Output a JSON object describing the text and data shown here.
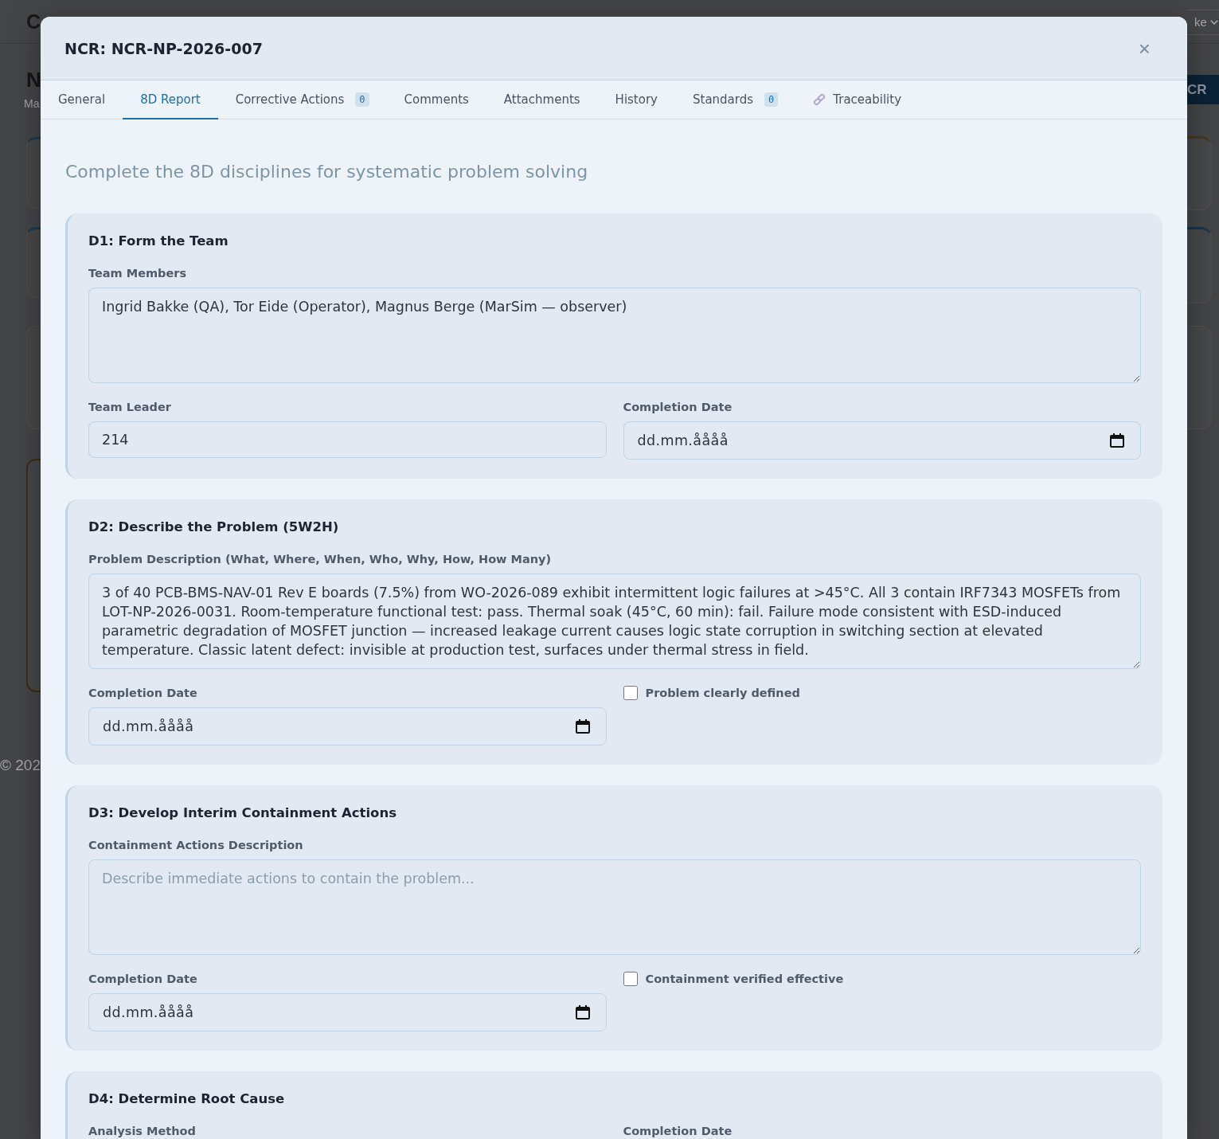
{
  "backdrop": {
    "logo": "C",
    "user_menu": "ke",
    "page_title": "N",
    "page_subtitle": "Ma",
    "action_button": "CR",
    "footer": "© 202"
  },
  "modal": {
    "title": "NCR: NCR-NP-2026-007",
    "close": "×"
  },
  "tabs": [
    {
      "kind": "plain",
      "label": "General",
      "selected": false
    },
    {
      "kind": "plain",
      "label": "8D Report",
      "selected": true
    },
    {
      "kind": "count",
      "label": "Corrective Actions",
      "badge": "0",
      "selected": false
    },
    {
      "kind": "plain",
      "label": "Comments",
      "selected": false
    },
    {
      "kind": "plain",
      "label": "Attachments",
      "selected": false
    },
    {
      "kind": "plain",
      "label": "History",
      "selected": false
    },
    {
      "kind": "count",
      "label": "Standards",
      "badge": "0",
      "selected": false
    },
    {
      "kind": "icon",
      "label": "Traceability",
      "selected": false
    }
  ],
  "intro": "Complete the 8D disciplines for systematic problem solving",
  "disciplines": [
    {
      "title": "D1: Form the Team",
      "fields": [
        {
          "kind": "textarea",
          "label": "Team Members",
          "value": "Ingrid Bakke (QA), Tor Eide (Operator), Magnus Berge (MarSim — observer)"
        },
        {
          "kind": "text",
          "label": "Team Leader",
          "value": "214"
        },
        {
          "kind": "date",
          "label": "Completion Date",
          "placeholder": "dd.mm.åååå"
        }
      ]
    },
    {
      "title": "D2: Describe the Problem (5W2H)",
      "fields": [
        {
          "kind": "textarea",
          "label": "Problem Description (What, Where, When, Who, Why, How, How Many)",
          "value": "3 of 40 PCB-BMS-NAV-01 Rev E boards (7.5%) from WO-2026-089 exhibit intermittent logic failures at >45°C. All 3 contain IRF7343 MOSFETs from LOT-NP-2026-0031. Room-temperature functional test: pass. Thermal soak (45°C, 60 min): fail. Failure mode consistent with ESD-induced parametric degradation of MOSFET junction — increased leakage current causes logic state corruption in switching section at elevated temperature. Classic latent defect: invisible at production test, surfaces under thermal stress in field."
        },
        {
          "kind": "date",
          "label": "Completion Date",
          "placeholder": "dd.mm.åååå"
        },
        {
          "kind": "checkbox",
          "label": "Problem clearly defined",
          "checked": false
        }
      ]
    },
    {
      "title": "D3: Develop Interim Containment Actions",
      "fields": [
        {
          "kind": "textarea",
          "label": "Containment Actions Description",
          "placeholder": "Describe immediate actions to contain the problem..."
        },
        {
          "kind": "date",
          "label": "Completion Date",
          "placeholder": "dd.mm.åååå"
        },
        {
          "kind": "checkbox",
          "label": "Containment verified effective",
          "checked": false
        }
      ]
    },
    {
      "title": "D4: Determine Root Cause",
      "fields": [
        {
          "label": "Analysis Method"
        },
        {
          "label": "Completion Date"
        }
      ]
    }
  ]
}
